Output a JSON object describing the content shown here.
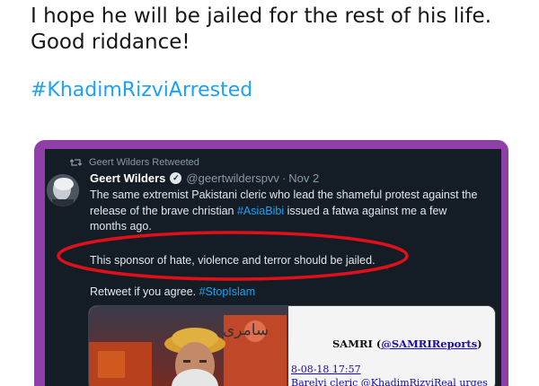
{
  "post": {
    "text_line1": "I hope he will be jailed for the rest of his life.",
    "text_line2": "Good riddance!",
    "hashtag": "#KhadimRizviArrested"
  },
  "embedded_tweet": {
    "retweet_label": "Geert Wilders Retweeted",
    "author_name": "Geert Wilders",
    "verified_mark": "✓",
    "handle": "@geertwilderspvv",
    "separator": "·",
    "date": "Nov 2",
    "body_part1": "The same extremist Pakistani cleric who lead the shameful protest against the release of the brave christian ",
    "body_tag": "#AsiaBibi",
    "body_part2": " issued a fatwa against me a few months ago.",
    "highlighted_line": "This sponsor of hate, violence and terror should be jailed.",
    "retweet_prefix": "Retweet if you agree. ",
    "retweet_tag": "#StopIslam"
  },
  "media": {
    "urdu_text": "سامری",
    "doc_title": "SAMRI (",
    "doc_title_link": "@SAMRIReports",
    "doc_title_end": ")",
    "doc_date": "8-08-18 17:57",
    "doc_snippet": "Barelvi cleric @KhadimRizviReal urges"
  },
  "colors": {
    "frame_purple": "#8f3fa8",
    "tweet_bg": "#141d26",
    "link_blue": "#1da1f2",
    "ellipse_red": "#e0101a"
  }
}
